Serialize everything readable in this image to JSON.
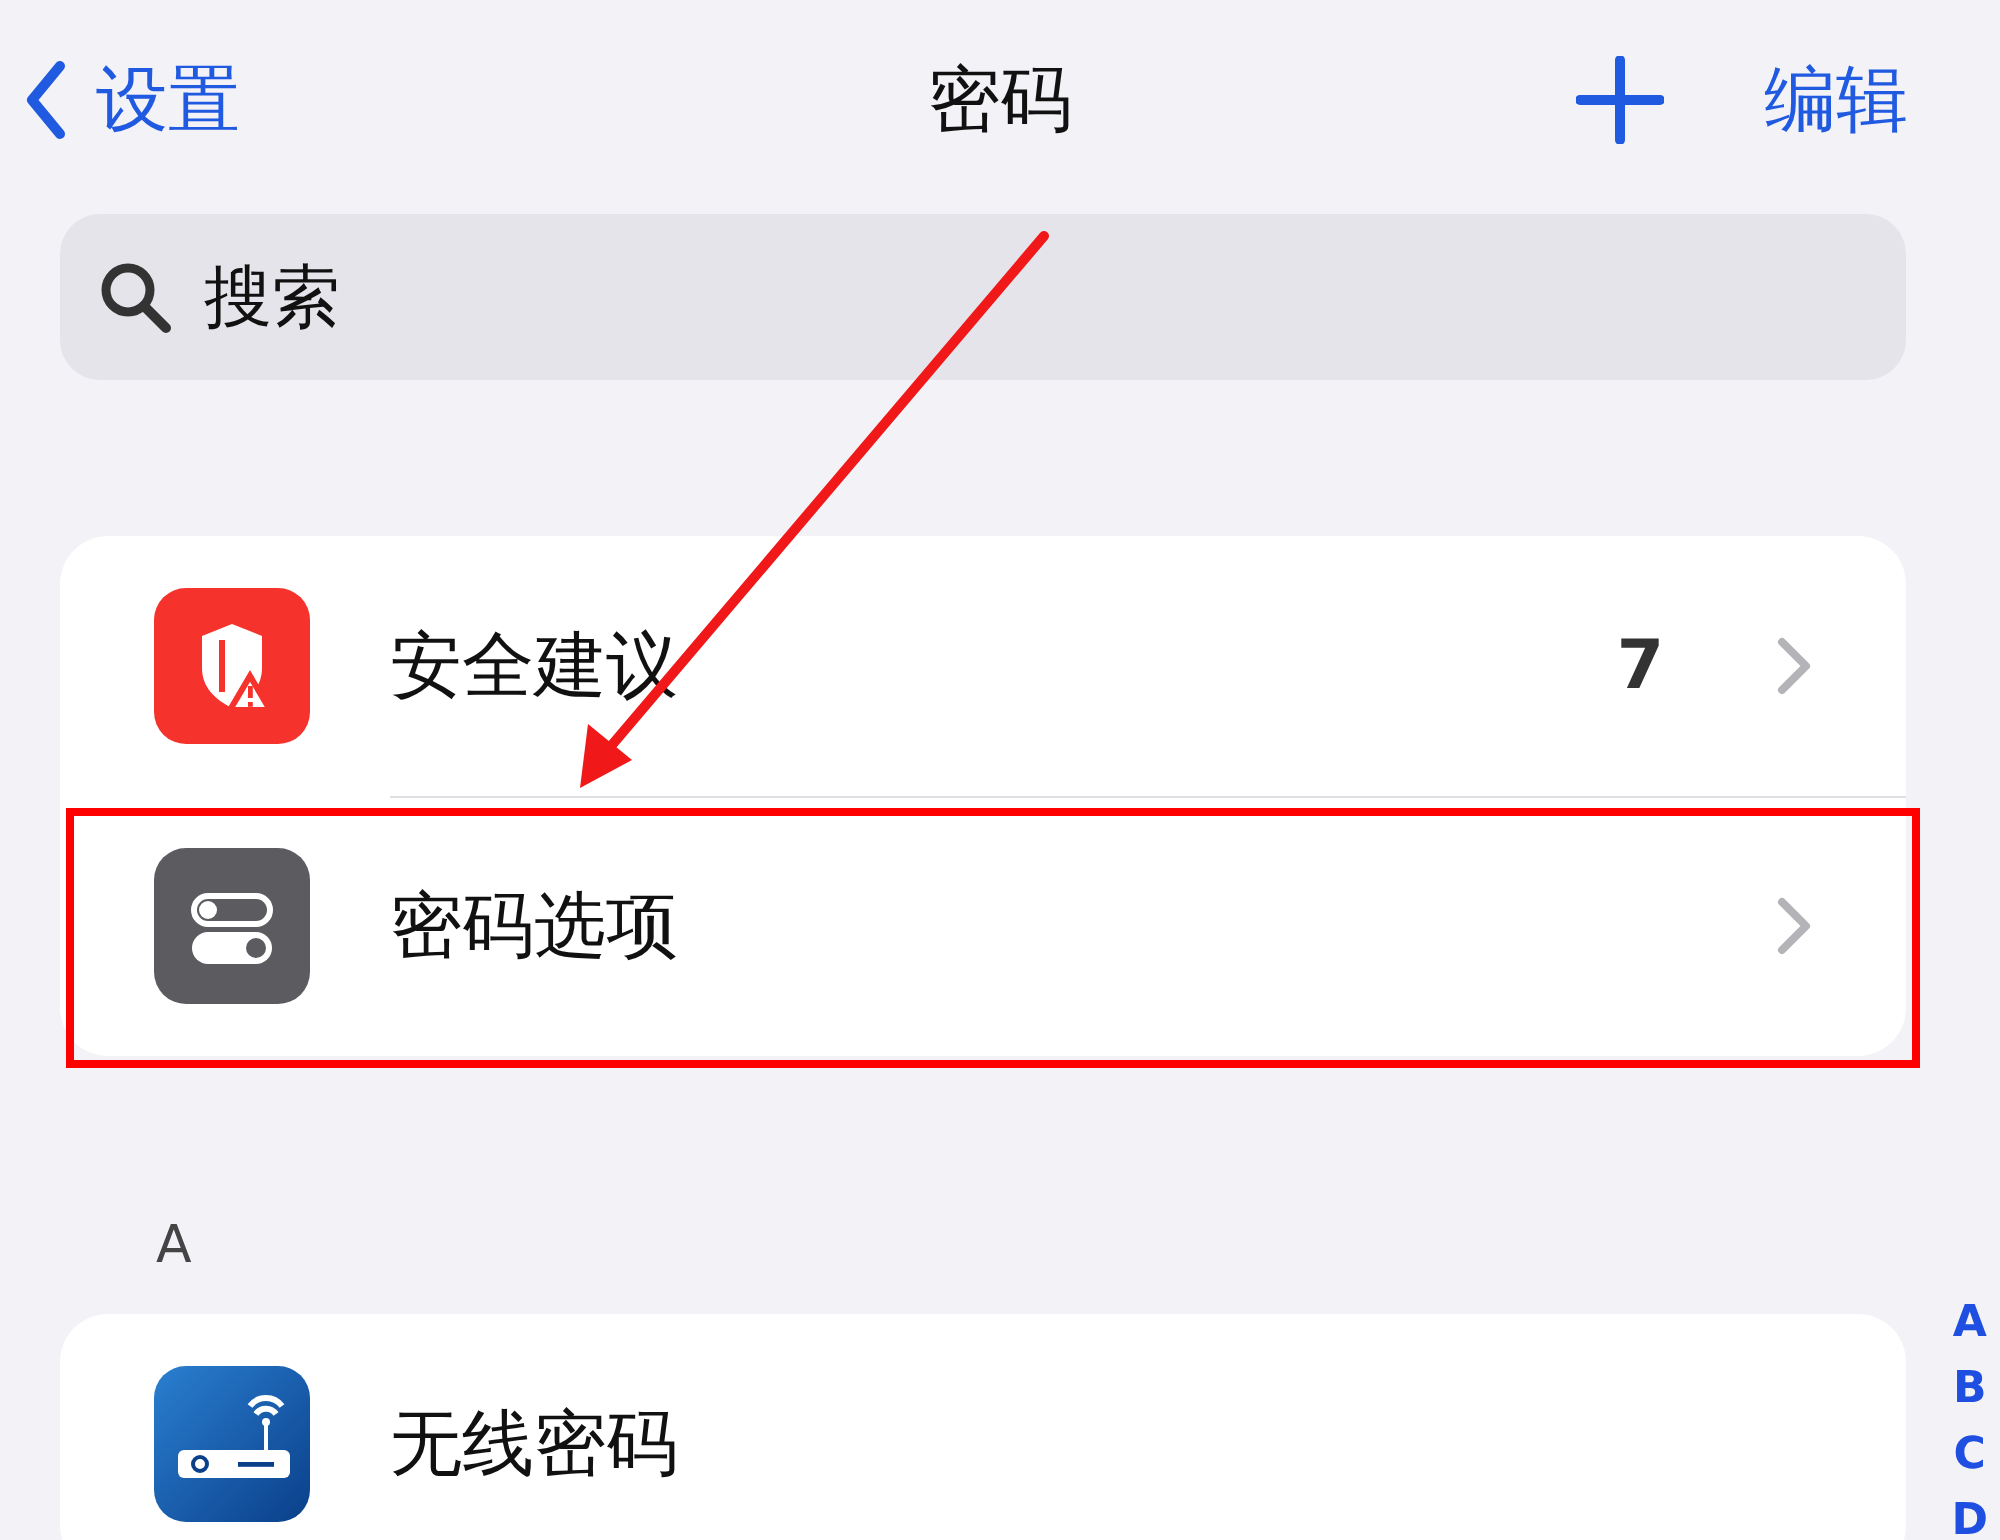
{
  "nav": {
    "back_label": "设置",
    "title": "密码",
    "edit_label": "编辑"
  },
  "search": {
    "placeholder": "搜索"
  },
  "top_rows": [
    {
      "kind": "security",
      "label": "安全建议",
      "count": "7",
      "chevron": true,
      "highlighted": false
    },
    {
      "kind": "options",
      "label": "密码选项",
      "chevron": true,
      "highlighted": true
    }
  ],
  "sections": [
    {
      "header": "A",
      "rows": [
        {
          "kind": "wifi",
          "label": "无线密码"
        }
      ]
    }
  ],
  "index": [
    "A",
    "B",
    "C",
    "D"
  ]
}
